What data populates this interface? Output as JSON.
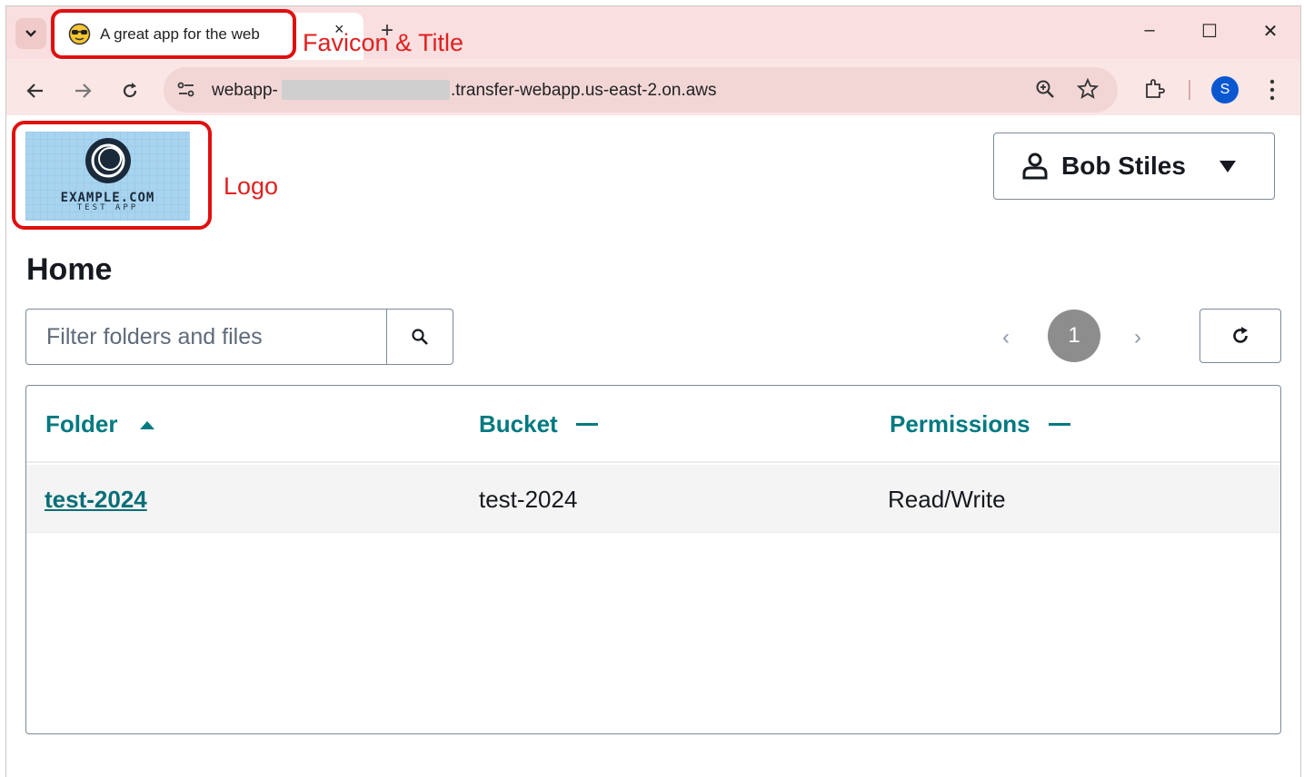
{
  "browser": {
    "tab_title": "A great app for the web",
    "tab_close": "×",
    "new_tab": "+",
    "url_start": "webapp-",
    "url_end": ".transfer-webapp.us-east-2.on.aws",
    "profile_initial": "S",
    "window_controls": {
      "minimize": "–",
      "maximize": "☐",
      "close": "✕"
    }
  },
  "annotations": {
    "favicon_title": "Favicon & Title",
    "logo": "Logo"
  },
  "header": {
    "logo_text": "EXAMPLE.COM",
    "logo_subtext": "TEST APP",
    "user_name": "Bob Stiles"
  },
  "main": {
    "title": "Home",
    "filter_placeholder": "Filter folders and files",
    "pagination": {
      "prev": "‹",
      "current": "1",
      "next": "›"
    },
    "table": {
      "columns": [
        {
          "label": "Folder",
          "sort": "ascending"
        },
        {
          "label": "Bucket",
          "sort": "none"
        },
        {
          "label": "Permissions",
          "sort": "none"
        }
      ],
      "rows": [
        {
          "folder": "test-2024",
          "bucket": "test-2024",
          "permissions": "Read/Write"
        }
      ]
    }
  },
  "colors": {
    "accent": "#007980",
    "annotation": "#e01010",
    "tab_bar": "#f9dfdf"
  }
}
